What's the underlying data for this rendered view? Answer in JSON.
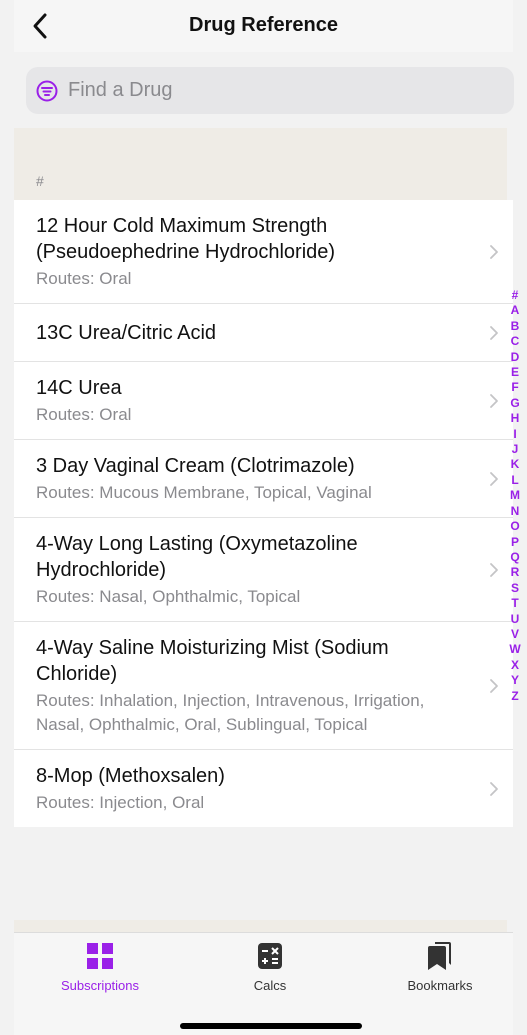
{
  "nav": {
    "title": "Drug Reference"
  },
  "search": {
    "placeholder": "Find a Drug"
  },
  "section": {
    "label": "#"
  },
  "drugs": [
    {
      "title": "12 Hour Cold Maximum Strength (Pseudoephedrine Hydrochloride)",
      "routes": "Routes: Oral"
    },
    {
      "title": "13C Urea/Citric Acid",
      "routes": ""
    },
    {
      "title": "14C Urea",
      "routes": "Routes: Oral"
    },
    {
      "title": "3 Day Vaginal Cream (Clotrimazole)",
      "routes": "Routes: Mucous Membrane, Topical, Vaginal"
    },
    {
      "title": "4-Way Long Lasting (Oxymetazoline Hydrochloride)",
      "routes": "Routes: Nasal, Ophthalmic, Topical"
    },
    {
      "title": "4-Way Saline Moisturizing Mist (Sodium Chloride)",
      "routes": "Routes: Inhalation, Injection, Intravenous, Irrigation, Nasal, Ophthalmic, Oral, Sublingual, Topical"
    },
    {
      "title": "8-Mop (Methoxsalen)",
      "routes": "Routes: Injection, Oral"
    }
  ],
  "index": [
    "#",
    "A",
    "B",
    "C",
    "D",
    "E",
    "F",
    "G",
    "H",
    "I",
    "J",
    "K",
    "L",
    "M",
    "N",
    "O",
    "P",
    "Q",
    "R",
    "S",
    "T",
    "U",
    "V",
    "W",
    "X",
    "Y",
    "Z"
  ],
  "tabs": {
    "subscriptions": "Subscriptions",
    "calcs": "Calcs",
    "bookmarks": "Bookmarks"
  },
  "colors": {
    "accent": "#9a20e8",
    "section_bg": "#efece6"
  },
  "icons": {
    "back": "chevron-left-icon",
    "search": "filter-circle-icon",
    "row": "chevron-right-icon",
    "subscriptions": "grid-squares-icon",
    "calcs": "calculator-icon",
    "bookmarks": "bookmarks-icon"
  }
}
